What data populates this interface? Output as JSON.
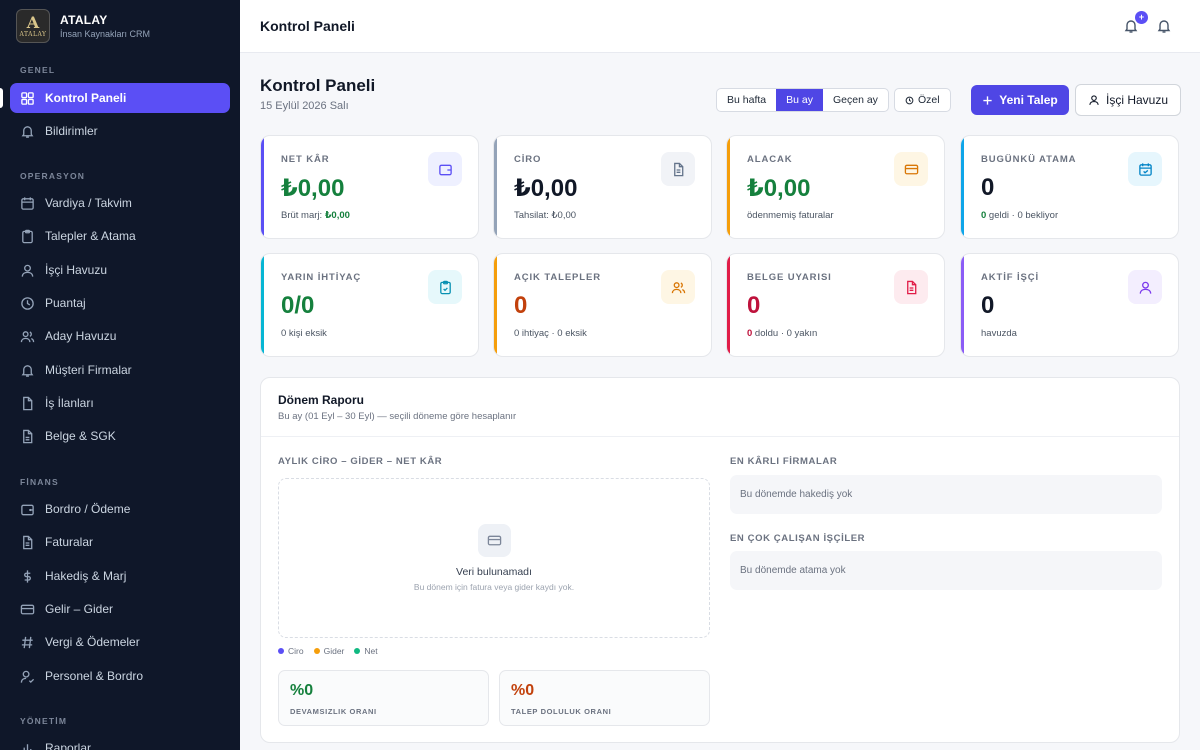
{
  "brand": {
    "logo_text": "A",
    "logo_small": "ATALAY",
    "name": "ATALAY",
    "subtitle": "İnsan Kaynakları CRM"
  },
  "sidebar": {
    "sections": [
      {
        "label": "GENEL",
        "items": [
          {
            "label": "Kontrol Paneli",
            "icon": "grid-icon",
            "active": true
          },
          {
            "label": "Bildirimler",
            "icon": "bell-icon"
          }
        ]
      },
      {
        "label": "OPERASYON",
        "items": [
          {
            "label": "Vardiya / Takvim",
            "icon": "calendar-icon"
          },
          {
            "label": "Talepler & Atama",
            "icon": "clipboard-icon"
          },
          {
            "label": "İşçi Havuzu",
            "icon": "user-icon"
          },
          {
            "label": "Puantaj",
            "icon": "clock-icon"
          },
          {
            "label": "Aday Havuzu",
            "icon": "users-icon"
          },
          {
            "label": "Müşteri Firmalar",
            "icon": "bell-icon"
          },
          {
            "label": "İş İlanları",
            "icon": "file-icon"
          },
          {
            "label": "Belge & SGK",
            "icon": "document-icon"
          }
        ]
      },
      {
        "label": "FİNANS",
        "items": [
          {
            "label": "Bordro / Ödeme",
            "icon": "wallet-icon"
          },
          {
            "label": "Faturalar",
            "icon": "file-text-icon"
          },
          {
            "label": "Hakediş & Marj",
            "icon": "dollar-icon"
          },
          {
            "label": "Gelir – Gider",
            "icon": "card-icon"
          },
          {
            "label": "Vergi & Ödemeler",
            "icon": "hash-icon"
          },
          {
            "label": "Personel & Bordro",
            "icon": "user-check-icon"
          }
        ]
      },
      {
        "label": "YÖNETİM",
        "items": [
          {
            "label": "Raporlar",
            "icon": "chart-icon"
          }
        ]
      }
    ]
  },
  "topbar": {
    "title": "Kontrol Paneli",
    "badge": "+"
  },
  "header": {
    "title": "Kontrol Paneli",
    "date": "15 Eylül 2026 Salı",
    "ranges": [
      "Bu hafta",
      "Bu ay",
      "Geçen ay"
    ],
    "custom_label": "Özel",
    "new_request": "Yeni Talep",
    "worker_pool": "İşçi Havuzu"
  },
  "colors": {
    "accent": "#5b4ff5",
    "green": "#15803d",
    "orange": "#c2410c",
    "red": "#be123c",
    "dark": "#111827"
  },
  "cards": [
    {
      "label": "NET KÂR",
      "value": "₺0,00",
      "sub_prefix": "Brüt marj: ",
      "sub_strong": "₺0,00",
      "sub_suffix": "",
      "icon": "wallet-icon"
    },
    {
      "label": "CİRO",
      "value": "₺0,00",
      "sub_prefix": "Tahsilat: ₺0,00",
      "sub_strong": "",
      "sub_suffix": "",
      "icon": "file-text-icon"
    },
    {
      "label": "ALACAK",
      "value": "₺0,00",
      "sub_prefix": "ödenmemiş faturalar",
      "sub_strong": "",
      "sub_suffix": "",
      "icon": "card-icon"
    },
    {
      "label": "BUGÜNKÜ ATAMA",
      "value": "0",
      "sub_prefix": "",
      "sub_strong": "0",
      "sub_suffix": " geldi · 0 bekliyor",
      "icon": "calendar-check-icon"
    },
    {
      "label": "YARIN İHTİYAÇ",
      "value": "0/0",
      "sub_prefix": "0 kişi eksik",
      "sub_strong": "",
      "sub_suffix": "",
      "icon": "clipboard-check-icon"
    },
    {
      "label": "AÇIK TALEPLER",
      "value": "0",
      "sub_prefix": "0 ihtiyaç · 0 eksik",
      "sub_strong": "",
      "sub_suffix": "",
      "icon": "users-icon"
    },
    {
      "label": "BELGE UYARISI",
      "value": "0",
      "sub_prefix": "",
      "sub_strong": "0",
      "sub_suffix": " doldu · 0 yakın",
      "icon": "file-alert-icon"
    },
    {
      "label": "AKTİF İŞÇİ",
      "value": "0",
      "sub_prefix": "havuzda",
      "sub_strong": "",
      "sub_suffix": "",
      "icon": "user-icon"
    }
  ],
  "report": {
    "title": "Dönem Raporu",
    "subtitle": "Bu ay (01 Eyl – 30 Eyl) — seçili döneme göre hesaplanır",
    "chart_label": "AYLIK CİRO – GİDER – NET KÂR",
    "empty_title": "Veri bulunamadı",
    "empty_sub": "Bu dönem için fatura veya gider kaydı yok.",
    "legend": [
      "Ciro",
      "Gider",
      "Net"
    ],
    "legend_colors": [
      "#5b4ff5",
      "#f59e0b",
      "#10b981"
    ],
    "rates": [
      {
        "value": "%0",
        "label": "DEVAMSIZLIK ORANI"
      },
      {
        "value": "%0",
        "label": "TALEP DOLULUK ORANI"
      }
    ],
    "top_firms_label": "EN KÂRLI FİRMALAR",
    "top_firms_empty": "Bu dönemde hakediş yok",
    "top_workers_label": "EN ÇOK ÇALIŞAN İŞÇİLER",
    "top_workers_empty": "Bu dönemde atama yok"
  }
}
